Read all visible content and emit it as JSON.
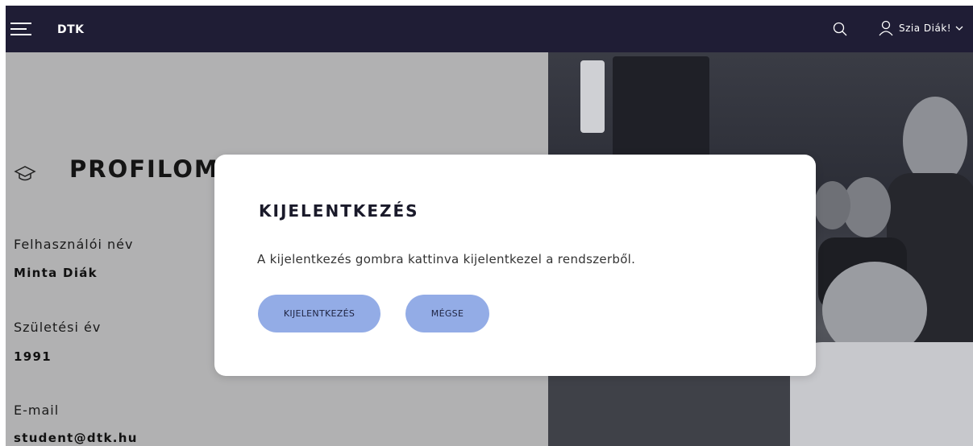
{
  "header": {
    "brand": "DTK",
    "user_greeting": "Szia Diák!",
    "icons": [
      "menu-icon",
      "search-icon",
      "user-icon",
      "chevron-down-icon"
    ]
  },
  "profile": {
    "title": "PROFILOM",
    "fields": [
      {
        "label": "Felhasználói név",
        "value": "Minta Diák"
      },
      {
        "label": "Születési év",
        "value": "1991"
      },
      {
        "label": "E-mail",
        "value": "student@dtk.hu"
      }
    ]
  },
  "modal": {
    "title": "KIJELENTKEZÉS",
    "message": "A kijelentkezés gombra kattinva kijelentkezel a rendszerből.",
    "confirm_label": "KIJELENTKEZÉS",
    "cancel_label": "MÉGSE"
  },
  "colors": {
    "topbar": "#1f1d35",
    "button": "#93ace6",
    "pane": "#b1b1b2"
  }
}
